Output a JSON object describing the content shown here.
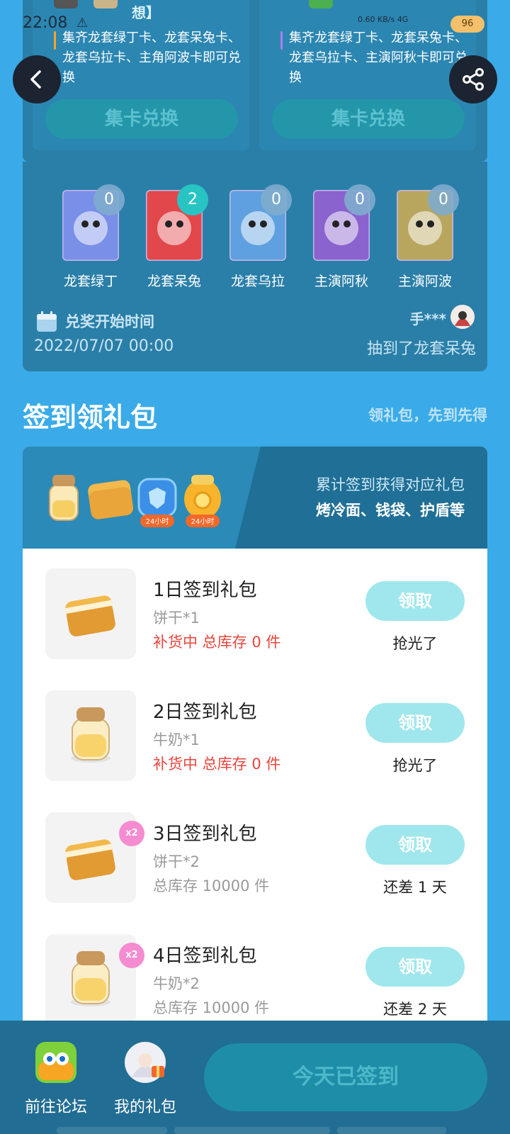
{
  "status_bar": {
    "time": "22:08",
    "net_speed": "0.60 KB/s",
    "network": "4G",
    "battery": "96"
  },
  "exchange": {
    "left": {
      "title_fragment": "想】",
      "desc": "集齐龙套绿丁卡、龙套呆兔卡、龙套乌拉卡、主角阿波卡即可兑换",
      "button": "集卡兑换"
    },
    "right": {
      "desc": "集齐龙套绿丁卡、龙套呆兔卡、龙套乌拉卡、主演阿秋卡即可兑换",
      "button": "集卡兑换"
    }
  },
  "cards": [
    {
      "name": "龙套绿丁",
      "count": "0",
      "color": "#7a8fe8"
    },
    {
      "name": "龙套呆兔",
      "count": "2",
      "color": "#e2484b"
    },
    {
      "name": "龙套乌拉",
      "count": "0",
      "color": "#5fa0e0"
    },
    {
      "name": "主演阿秋",
      "count": "0",
      "color": "#8a63cf"
    },
    {
      "name": "主演阿波",
      "count": "0",
      "color": "#b9a65e"
    }
  ],
  "redeem": {
    "label": "兑奖开始时间",
    "date": "2022/07/07 00:00"
  },
  "winner": {
    "name": "手***",
    "text": "抽到了龙套呆兔"
  },
  "sign_section": {
    "title": "签到领礼包",
    "subtitle": "领礼包，先到先得"
  },
  "banner": {
    "line1": "累计签到获得对应礼包",
    "line2": "烤冷面、钱袋、护盾等",
    "tag": "24小时"
  },
  "packages": [
    {
      "title": "1日签到礼包",
      "item": "饼干*1",
      "stock": "补货中 总库存 0 件",
      "stock_style": "red",
      "button": "领取",
      "status": "抢光了",
      "icon": "biscuit-icon",
      "double": false
    },
    {
      "title": "2日签到礼包",
      "item": "牛奶*1",
      "stock": "补货中 总库存 0 件",
      "stock_style": "red",
      "button": "领取",
      "status": "抢光了",
      "icon": "milk-jar-icon",
      "double": false
    },
    {
      "title": "3日签到礼包",
      "item": "饼干*2",
      "stock": "总库存 10000 件",
      "stock_style": "gray",
      "button": "领取",
      "status": "还差 1 天",
      "icon": "biscuit-icon",
      "double": true
    },
    {
      "title": "4日签到礼包",
      "item": "牛奶*2",
      "stock": "总库存 10000 件",
      "stock_style": "gray",
      "button": "领取",
      "status": "还差 2 天",
      "icon": "milk-jar-icon",
      "double": true
    }
  ],
  "double_badge": "x2",
  "bottom_bar": {
    "forum_label": "前往论坛",
    "gifts_label": "我的礼包",
    "signed_button": "今天已签到"
  },
  "colors": {
    "page_bg": "#3aabe8",
    "panel_bg": "#2a7fa8",
    "claim_button": "#9fe7ec",
    "stock_red": "#e8453c",
    "bottom_bar": "#226d93"
  }
}
